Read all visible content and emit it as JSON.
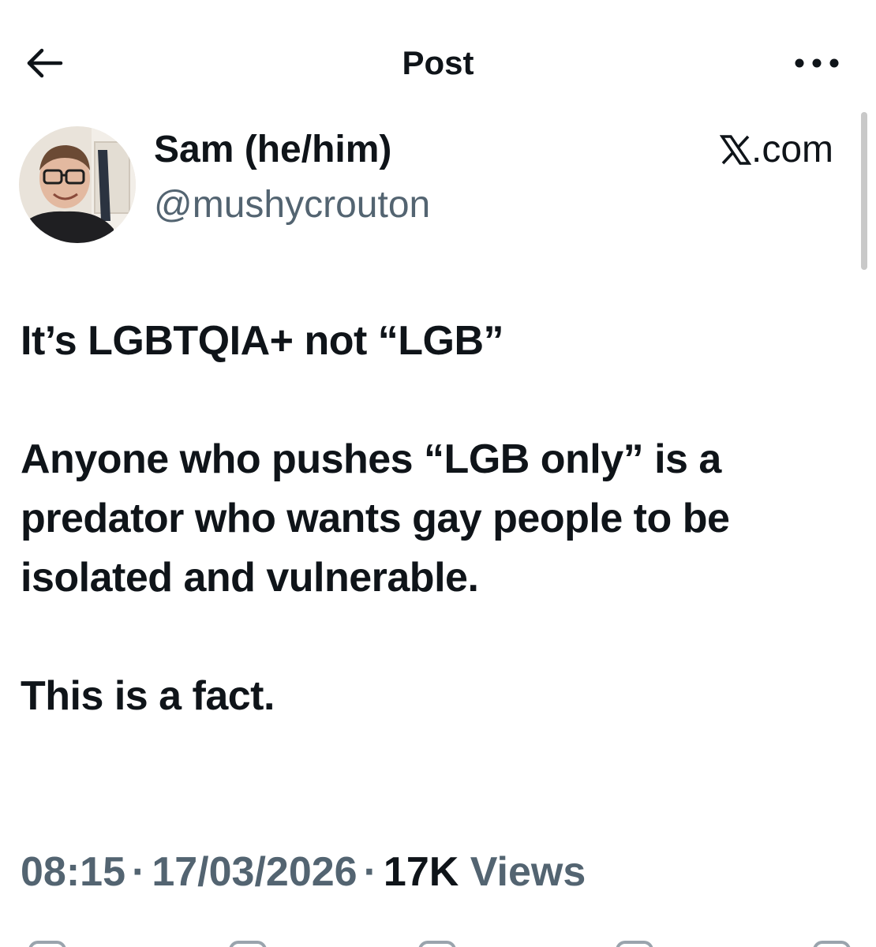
{
  "header": {
    "title": "Post",
    "back_icon": "arrow-left-icon",
    "more_icon": "more-horizontal-icon"
  },
  "author": {
    "display_name": "Sam (he/him)",
    "handle": "@mushycrouton"
  },
  "source": {
    "logo_icon": "x-logo-icon",
    "domain_text": ".com"
  },
  "post": {
    "paragraphs": [
      "It’s LGBTQIA+ not “LGB”",
      "Anyone who pushes “LGB only” is a predator who wants gay people to be isolated and vulnerable.",
      "This is a fact."
    ]
  },
  "meta": {
    "time": "08:15",
    "separator": "·",
    "date": "17/03/2026",
    "views_count": "17K",
    "views_label": "Views"
  },
  "colors": {
    "text_primary": "#0f1419",
    "text_secondary": "#536471",
    "background": "#ffffff"
  }
}
